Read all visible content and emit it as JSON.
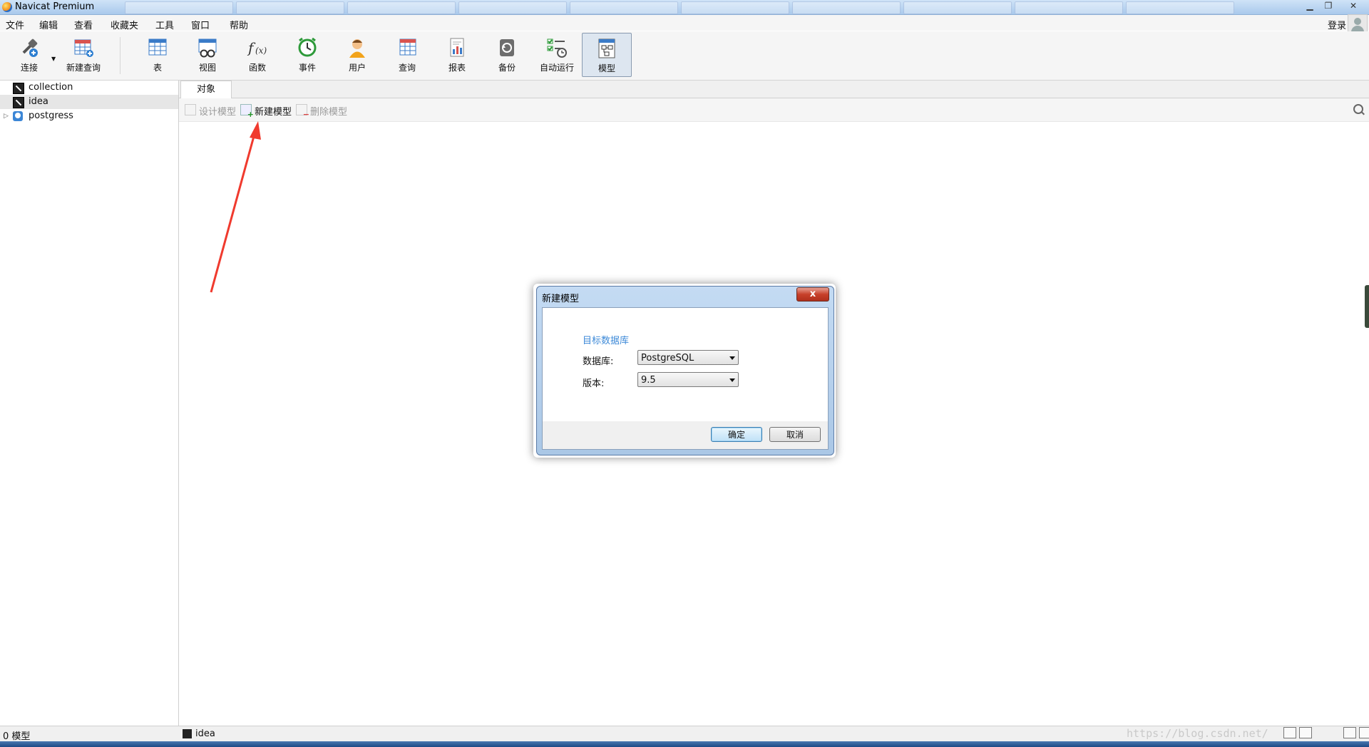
{
  "window": {
    "title": "Navicat Premium"
  },
  "menu": [
    "文件",
    "编辑",
    "查看",
    "收藏夹",
    "工具",
    "窗口",
    "帮助"
  ],
  "account": {
    "login": "登录"
  },
  "toolbar": {
    "connect": "连接",
    "new_query": "新建查询",
    "table": "表",
    "view": "视图",
    "function": "函数",
    "event": "事件",
    "user": "用户",
    "query": "查询",
    "report": "报表",
    "backup": "备份",
    "automation": "自动运行",
    "model": "模型"
  },
  "connections": [
    "collection",
    "idea",
    "postgress"
  ],
  "objects": {
    "tab": "对象",
    "design_model": "设计模型",
    "new_model": "新建模型",
    "delete_model": "删除模型"
  },
  "dialog": {
    "title": "新建模型",
    "close": "x",
    "section": "目标数据库",
    "db_label": "数据库:",
    "db_value": "PostgreSQL",
    "ver_label": "版本:",
    "ver_value": "9.5",
    "ok": "确定",
    "cancel": "取消"
  },
  "status": {
    "count": "0 模型",
    "connection": "idea",
    "watermark": "https://blog.csdn.net/"
  },
  "colors": {
    "annotation_arrow": "#f03a2e",
    "section_title": "#3e8ad8"
  }
}
